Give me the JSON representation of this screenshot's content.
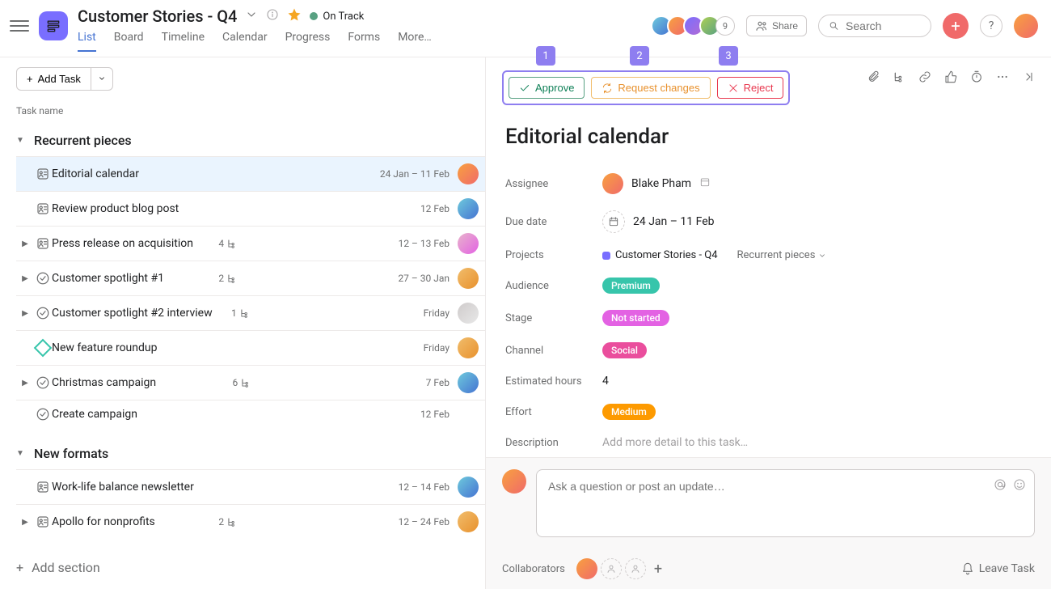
{
  "header": {
    "title": "Customer Stories - Q4",
    "status": "On Track",
    "tabs": [
      "List",
      "Board",
      "Timeline",
      "Calendar",
      "Progress",
      "Forms",
      "More…"
    ],
    "active_tab": 0,
    "avatar_overflow": "9",
    "share": "Share",
    "search_placeholder": "Search"
  },
  "annotation_badges": [
    "1",
    "2",
    "3"
  ],
  "toolbar": {
    "add_task": "Add Task",
    "col_task_name": "Task name",
    "add_section": "Add section"
  },
  "sections": [
    {
      "title": "Recurrent pieces",
      "tasks": [
        {
          "name": "Editorial calendar",
          "date": "24 Jan – 11 Feb",
          "icon": "approval",
          "selected": true,
          "avatar": "av-2",
          "has_children": false
        },
        {
          "name": "Review product blog post",
          "date": "12 Feb",
          "icon": "approval",
          "avatar": "av-1",
          "has_children": false
        },
        {
          "name": "Press release on acquisition",
          "date": "12 – 13 Feb",
          "icon": "approval",
          "count": "4",
          "avatar": "av-6",
          "has_children": true
        },
        {
          "name": "Customer spotlight #1",
          "date": "27 – 30 Jan",
          "icon": "check",
          "count": "2",
          "avatar": "av-5",
          "has_children": true
        },
        {
          "name": "Customer spotlight #2 interview",
          "date": "Friday",
          "icon": "check",
          "count": "1",
          "avatar": "av-7",
          "has_children": true
        },
        {
          "name": "New feature roundup",
          "date": "Friday",
          "icon": "diamond",
          "avatar": "av-5",
          "has_children": false
        },
        {
          "name": "Christmas campaign",
          "date": "7 Feb",
          "icon": "check",
          "count": "6",
          "avatar": "av-1",
          "has_children": true
        },
        {
          "name": "Create campaign",
          "date": "12 Feb",
          "icon": "check",
          "has_children": false
        }
      ]
    },
    {
      "title": "New formats",
      "tasks": [
        {
          "name": "Work-life balance newsletter",
          "date": "12 – 14 Feb",
          "icon": "approval",
          "avatar": "av-1",
          "has_children": false
        },
        {
          "name": "Apollo for nonprofits",
          "date": "12 – 24 Feb",
          "icon": "approval",
          "count": "2",
          "avatar": "av-5",
          "has_children": true
        }
      ]
    }
  ],
  "detail": {
    "approval": {
      "approve": "Approve",
      "request": "Request changes",
      "reject": "Reject"
    },
    "title": "Editorial calendar",
    "fields": {
      "assignee_label": "Assignee",
      "assignee": "Blake Pham",
      "due_label": "Due date",
      "due": "24 Jan – 11 Feb",
      "projects_label": "Projects",
      "project": "Customer Stories - Q4",
      "section": "Recurrent pieces",
      "audience_label": "Audience",
      "audience": "Premium",
      "stage_label": "Stage",
      "stage": "Not started",
      "channel_label": "Channel",
      "channel": "Social",
      "hours_label": "Estimated hours",
      "hours": "4",
      "effort_label": "Effort",
      "effort": "Medium",
      "desc_label": "Description",
      "desc_placeholder": "Add more detail to this task…"
    },
    "comment_placeholder": "Ask a question or post an update…",
    "collaborators_label": "Collaborators",
    "leave": "Leave Task"
  }
}
